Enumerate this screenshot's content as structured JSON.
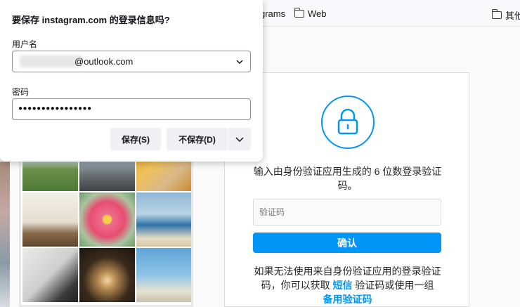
{
  "bookmarks": {
    "items": [
      {
        "label": "grams"
      },
      {
        "label": "Web"
      },
      {
        "label": "其他"
      }
    ]
  },
  "popup": {
    "title": "要保存 instagram.com 的登录信息吗?",
    "username_label": "用户名",
    "username_value": "@outlook.com",
    "password_label": "密码",
    "password_value": "●●●●●●●●●●●●●●●●",
    "save_label": "保存(S)",
    "dont_save_label": "不保存(D)"
  },
  "card": {
    "description": "输入由身份验证应用生成的 6 位数登录验证码。",
    "code_placeholder": "验证码",
    "confirm_label": "确认",
    "help_prefix": "如果无法使用来自身份验证应用的登录验证码，你可以获取",
    "help_sms_link": "短信",
    "help_middle": "验证码或使用一组",
    "help_backup_link": "备用验证码",
    "accent_color": "#0095f6"
  }
}
